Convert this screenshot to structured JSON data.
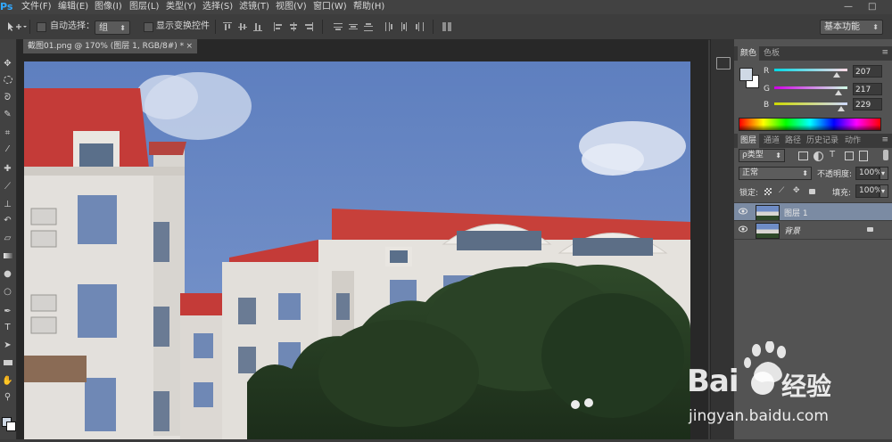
{
  "app": {
    "logo": "Ps"
  },
  "menu": [
    "文件(F)",
    "编辑(E)",
    "图像(I)",
    "图层(L)",
    "类型(Y)",
    "选择(S)",
    "滤镜(T)",
    "视图(V)",
    "窗口(W)",
    "帮助(H)"
  ],
  "window_controls": {
    "minimize": "—",
    "maximize": "□"
  },
  "options_bar": {
    "auto_select_label": "自动选择：",
    "auto_select_value": "组",
    "show_transform_label": "显示变换控件",
    "workspace": "基本功能"
  },
  "document": {
    "tab_title": "截图01.png @ 170% (图层 1, RGB/8#) *",
    "close": "×"
  },
  "color_panel": {
    "tabs": [
      "颜色",
      "色板"
    ],
    "r_label": "R",
    "r": "207",
    "g_label": "G",
    "g": "217",
    "b_label": "B",
    "b": "229",
    "fg_color": "#cfd9e5",
    "bg_color": "#ffffff"
  },
  "layers_panel": {
    "tabs": [
      "图层",
      "通道",
      "路径",
      "历史记录",
      "动作"
    ],
    "filter_label": "ρ类型",
    "blend_mode": "正常",
    "opacity_label": "不透明度:",
    "opacity": "100%",
    "lock_label": "锁定:",
    "fill_label": "填充:",
    "fill": "100%",
    "layers": [
      {
        "name": "图层 1",
        "selected": true
      },
      {
        "name": "背景",
        "selected": false,
        "locked": true,
        "italic": true
      }
    ]
  },
  "watermark": {
    "brand_left": "Bai",
    "brand_right": "经验",
    "url": "jingyan.baidu.com"
  }
}
